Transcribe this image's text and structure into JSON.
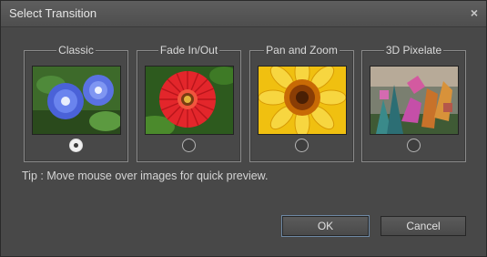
{
  "window": {
    "title": "Select Transition",
    "close_symbol": "×"
  },
  "transitions": [
    {
      "label": "Classic",
      "image": "blue-morning-glory-flowers",
      "selected": true
    },
    {
      "label": "Fade In/Out",
      "image": "red-gerbera-daisy",
      "selected": false
    },
    {
      "label": "Pan and Zoom",
      "image": "yellow-sunflower-closeup",
      "selected": false
    },
    {
      "label": "3D Pixelate",
      "image": "pink-tulips-pixelated",
      "selected": false
    }
  ],
  "tip": "Tip : Move mouse over images for quick preview.",
  "buttons": {
    "ok": "OK",
    "cancel": "Cancel"
  },
  "colors": {
    "dialog_bg": "#484848",
    "ok_focus": "#6f89a5"
  }
}
